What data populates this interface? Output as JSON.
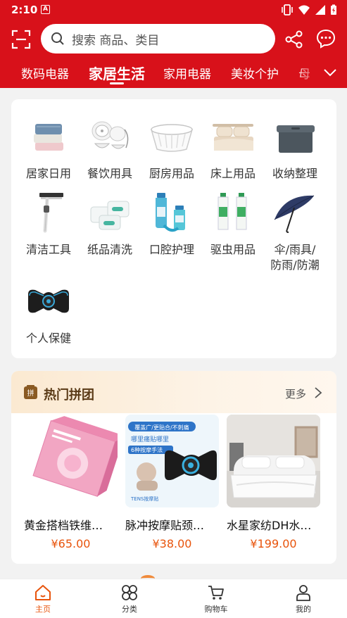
{
  "status": {
    "time": "2:10",
    "badge": "A"
  },
  "search": {
    "placeholder": "搜索 商品、类目"
  },
  "tabs": [
    {
      "label": "数码电器"
    },
    {
      "label": "家居生活"
    },
    {
      "label": "家用电器"
    },
    {
      "label": "美妆个护"
    },
    {
      "label": "母"
    }
  ],
  "categories": [
    {
      "label": "居家日用",
      "icon": "towels-icon"
    },
    {
      "label": "餐饮用具",
      "icon": "tableware-icon"
    },
    {
      "label": "厨房用品",
      "icon": "basket-icon"
    },
    {
      "label": "床上用品",
      "icon": "bedding-icon"
    },
    {
      "label": "收纳整理",
      "icon": "storage-box-icon"
    },
    {
      "label": "清洁工具",
      "icon": "squeegee-icon"
    },
    {
      "label": "纸品清洗",
      "icon": "tissues-icon"
    },
    {
      "label": "口腔护理",
      "icon": "mouthwash-icon"
    },
    {
      "label": "驱虫用品",
      "icon": "spray-icon"
    },
    {
      "label": "伞/雨具/防雨/防潮",
      "line1": "伞/雨具/",
      "line2": "防雨/防潮",
      "icon": "umbrella-icon"
    },
    {
      "label": "个人保健",
      "icon": "massager-icon"
    }
  ],
  "group_buy": {
    "title": "热门拼团",
    "more": "更多",
    "badge": "拼",
    "products": [
      {
        "name": "黄金搭档铁维…",
        "price": "¥65.00"
      },
      {
        "name": "脉冲按摩贴颈…",
        "price": "¥38.00",
        "img_text_1": "覆盖广/更贴合/不刺痛",
        "img_text_2": "哪里痛贴哪里",
        "img_text_3": "6种按摩手法",
        "img_text_4": "TENS按摩贴"
      },
      {
        "name": "水星家纺DH水…",
        "price": "¥199.00"
      }
    ]
  },
  "bottom_nav": [
    {
      "label": "主页",
      "icon": "home-icon"
    },
    {
      "label": "分类",
      "icon": "category-icon"
    },
    {
      "label": "购物车",
      "icon": "cart-icon"
    },
    {
      "label": "我的",
      "icon": "user-icon"
    }
  ],
  "colors": {
    "brand": "#d8111a",
    "accent": "#e8540c"
  }
}
